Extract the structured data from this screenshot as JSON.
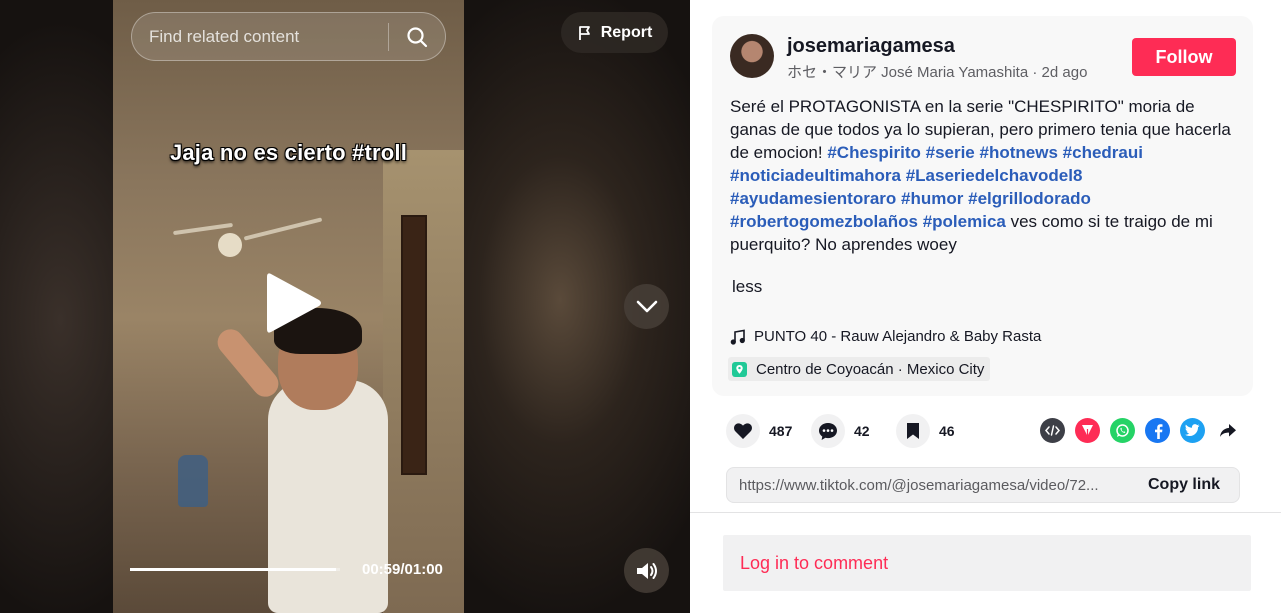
{
  "search": {
    "placeholder": "Find related content"
  },
  "report": {
    "label": "Report"
  },
  "video": {
    "caption_overlay": "Jaja no es cierto #troll",
    "progress_fraction": 0.98,
    "time": "00:59/01:00"
  },
  "post": {
    "username": "josemariagamesa",
    "display_name": "ホセ・マリア José Maria Yamashita",
    "separator": " · ",
    "posted": "2d ago",
    "follow_label": "Follow",
    "description_parts": [
      {
        "text": "Seré el PROTAGONISTA en la serie \"CHESPIRITO\" moria de ganas de que todos ya lo supieran, pero primero tenia que hacerla de emocion! ",
        "tag": false
      },
      {
        "text": "#Chespirito",
        "tag": true
      },
      {
        "text": " ",
        "tag": false
      },
      {
        "text": "#serie",
        "tag": true
      },
      {
        "text": " ",
        "tag": false
      },
      {
        "text": "#hotnews",
        "tag": true
      },
      {
        "text": " ",
        "tag": false
      },
      {
        "text": "#chedraui",
        "tag": true
      },
      {
        "text": " ",
        "tag": false
      },
      {
        "text": "#noticiadeultimahora",
        "tag": true
      },
      {
        "text": " ",
        "tag": false
      },
      {
        "text": "#Laseriedelchavodel8",
        "tag": true
      },
      {
        "text": " ",
        "tag": false
      },
      {
        "text": "#ayudamesientoraro",
        "tag": true
      },
      {
        "text": " ",
        "tag": false
      },
      {
        "text": "#humor",
        "tag": true
      },
      {
        "text": " ",
        "tag": false
      },
      {
        "text": "#elgrillodorado",
        "tag": true
      },
      {
        "text": " ",
        "tag": false
      },
      {
        "text": "#robertogomezbolaños",
        "tag": true
      },
      {
        "text": " ",
        "tag": false
      },
      {
        "text": "#polemica",
        "tag": true
      },
      {
        "text": " ves como si te traigo de mi puerquito? No aprendes woey",
        "tag": false
      }
    ],
    "less_label": "less",
    "music": "PUNTO 40 - Rauw Alejandro & Baby Rasta",
    "location": "Centro de Coyoacán · Mexico City"
  },
  "actions": {
    "likes": "487",
    "comments": "42",
    "saves": "46"
  },
  "share": {
    "icons": [
      "embed-icon",
      "send-icon",
      "whatsapp-icon",
      "facebook-icon",
      "twitter-icon",
      "share-arrow-icon"
    ],
    "colors": {
      "embed": "#3d3f47",
      "send": "#fe2c55",
      "whatsapp": "#25d366",
      "facebook": "#1877f2",
      "twitter": "#1da1f2"
    }
  },
  "link": {
    "url": "https://www.tiktok.com/@josemariagamesa/video/72...",
    "copy_label": "Copy link"
  },
  "comments": {
    "login_label": "Log in to comment"
  },
  "colors": {
    "accent": "#fe2c55",
    "hashtag": "#2b5db9"
  }
}
